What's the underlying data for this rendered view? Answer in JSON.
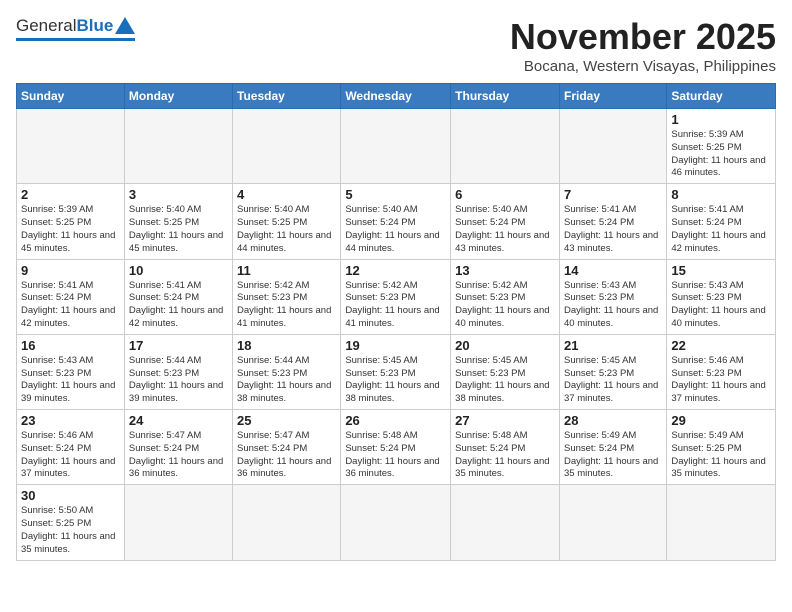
{
  "header": {
    "logo_general": "General",
    "logo_blue": "Blue",
    "month_title": "November 2025",
    "location": "Bocana, Western Visayas, Philippines"
  },
  "weekdays": [
    "Sunday",
    "Monday",
    "Tuesday",
    "Wednesday",
    "Thursday",
    "Friday",
    "Saturday"
  ],
  "days": [
    {
      "num": "",
      "sunrise": "",
      "sunset": "",
      "daylight": "",
      "empty": true
    },
    {
      "num": "",
      "sunrise": "",
      "sunset": "",
      "daylight": "",
      "empty": true
    },
    {
      "num": "",
      "sunrise": "",
      "sunset": "",
      "daylight": "",
      "empty": true
    },
    {
      "num": "",
      "sunrise": "",
      "sunset": "",
      "daylight": "",
      "empty": true
    },
    {
      "num": "",
      "sunrise": "",
      "sunset": "",
      "daylight": "",
      "empty": true
    },
    {
      "num": "",
      "sunrise": "",
      "sunset": "",
      "daylight": "",
      "empty": true
    },
    {
      "num": "1",
      "sunrise": "Sunrise: 5:39 AM",
      "sunset": "Sunset: 5:25 PM",
      "daylight": "Daylight: 11 hours and 46 minutes.",
      "empty": false
    },
    {
      "num": "2",
      "sunrise": "Sunrise: 5:39 AM",
      "sunset": "Sunset: 5:25 PM",
      "daylight": "Daylight: 11 hours and 45 minutes.",
      "empty": false
    },
    {
      "num": "3",
      "sunrise": "Sunrise: 5:40 AM",
      "sunset": "Sunset: 5:25 PM",
      "daylight": "Daylight: 11 hours and 45 minutes.",
      "empty": false
    },
    {
      "num": "4",
      "sunrise": "Sunrise: 5:40 AM",
      "sunset": "Sunset: 5:25 PM",
      "daylight": "Daylight: 11 hours and 44 minutes.",
      "empty": false
    },
    {
      "num": "5",
      "sunrise": "Sunrise: 5:40 AM",
      "sunset": "Sunset: 5:24 PM",
      "daylight": "Daylight: 11 hours and 44 minutes.",
      "empty": false
    },
    {
      "num": "6",
      "sunrise": "Sunrise: 5:40 AM",
      "sunset": "Sunset: 5:24 PM",
      "daylight": "Daylight: 11 hours and 43 minutes.",
      "empty": false
    },
    {
      "num": "7",
      "sunrise": "Sunrise: 5:41 AM",
      "sunset": "Sunset: 5:24 PM",
      "daylight": "Daylight: 11 hours and 43 minutes.",
      "empty": false
    },
    {
      "num": "8",
      "sunrise": "Sunrise: 5:41 AM",
      "sunset": "Sunset: 5:24 PM",
      "daylight": "Daylight: 11 hours and 42 minutes.",
      "empty": false
    },
    {
      "num": "9",
      "sunrise": "Sunrise: 5:41 AM",
      "sunset": "Sunset: 5:24 PM",
      "daylight": "Daylight: 11 hours and 42 minutes.",
      "empty": false
    },
    {
      "num": "10",
      "sunrise": "Sunrise: 5:41 AM",
      "sunset": "Sunset: 5:24 PM",
      "daylight": "Daylight: 11 hours and 42 minutes.",
      "empty": false
    },
    {
      "num": "11",
      "sunrise": "Sunrise: 5:42 AM",
      "sunset": "Sunset: 5:23 PM",
      "daylight": "Daylight: 11 hours and 41 minutes.",
      "empty": false
    },
    {
      "num": "12",
      "sunrise": "Sunrise: 5:42 AM",
      "sunset": "Sunset: 5:23 PM",
      "daylight": "Daylight: 11 hours and 41 minutes.",
      "empty": false
    },
    {
      "num": "13",
      "sunrise": "Sunrise: 5:42 AM",
      "sunset": "Sunset: 5:23 PM",
      "daylight": "Daylight: 11 hours and 40 minutes.",
      "empty": false
    },
    {
      "num": "14",
      "sunrise": "Sunrise: 5:43 AM",
      "sunset": "Sunset: 5:23 PM",
      "daylight": "Daylight: 11 hours and 40 minutes.",
      "empty": false
    },
    {
      "num": "15",
      "sunrise": "Sunrise: 5:43 AM",
      "sunset": "Sunset: 5:23 PM",
      "daylight": "Daylight: 11 hours and 40 minutes.",
      "empty": false
    },
    {
      "num": "16",
      "sunrise": "Sunrise: 5:43 AM",
      "sunset": "Sunset: 5:23 PM",
      "daylight": "Daylight: 11 hours and 39 minutes.",
      "empty": false
    },
    {
      "num": "17",
      "sunrise": "Sunrise: 5:44 AM",
      "sunset": "Sunset: 5:23 PM",
      "daylight": "Daylight: 11 hours and 39 minutes.",
      "empty": false
    },
    {
      "num": "18",
      "sunrise": "Sunrise: 5:44 AM",
      "sunset": "Sunset: 5:23 PM",
      "daylight": "Daylight: 11 hours and 38 minutes.",
      "empty": false
    },
    {
      "num": "19",
      "sunrise": "Sunrise: 5:45 AM",
      "sunset": "Sunset: 5:23 PM",
      "daylight": "Daylight: 11 hours and 38 minutes.",
      "empty": false
    },
    {
      "num": "20",
      "sunrise": "Sunrise: 5:45 AM",
      "sunset": "Sunset: 5:23 PM",
      "daylight": "Daylight: 11 hours and 38 minutes.",
      "empty": false
    },
    {
      "num": "21",
      "sunrise": "Sunrise: 5:45 AM",
      "sunset": "Sunset: 5:23 PM",
      "daylight": "Daylight: 11 hours and 37 minutes.",
      "empty": false
    },
    {
      "num": "22",
      "sunrise": "Sunrise: 5:46 AM",
      "sunset": "Sunset: 5:23 PM",
      "daylight": "Daylight: 11 hours and 37 minutes.",
      "empty": false
    },
    {
      "num": "23",
      "sunrise": "Sunrise: 5:46 AM",
      "sunset": "Sunset: 5:24 PM",
      "daylight": "Daylight: 11 hours and 37 minutes.",
      "empty": false
    },
    {
      "num": "24",
      "sunrise": "Sunrise: 5:47 AM",
      "sunset": "Sunset: 5:24 PM",
      "daylight": "Daylight: 11 hours and 36 minutes.",
      "empty": false
    },
    {
      "num": "25",
      "sunrise": "Sunrise: 5:47 AM",
      "sunset": "Sunset: 5:24 PM",
      "daylight": "Daylight: 11 hours and 36 minutes.",
      "empty": false
    },
    {
      "num": "26",
      "sunrise": "Sunrise: 5:48 AM",
      "sunset": "Sunset: 5:24 PM",
      "daylight": "Daylight: 11 hours and 36 minutes.",
      "empty": false
    },
    {
      "num": "27",
      "sunrise": "Sunrise: 5:48 AM",
      "sunset": "Sunset: 5:24 PM",
      "daylight": "Daylight: 11 hours and 35 minutes.",
      "empty": false
    },
    {
      "num": "28",
      "sunrise": "Sunrise: 5:49 AM",
      "sunset": "Sunset: 5:24 PM",
      "daylight": "Daylight: 11 hours and 35 minutes.",
      "empty": false
    },
    {
      "num": "29",
      "sunrise": "Sunrise: 5:49 AM",
      "sunset": "Sunset: 5:25 PM",
      "daylight": "Daylight: 11 hours and 35 minutes.",
      "empty": false
    },
    {
      "num": "30",
      "sunrise": "Sunrise: 5:50 AM",
      "sunset": "Sunset: 5:25 PM",
      "daylight": "Daylight: 11 hours and 35 minutes.",
      "empty": false
    }
  ]
}
